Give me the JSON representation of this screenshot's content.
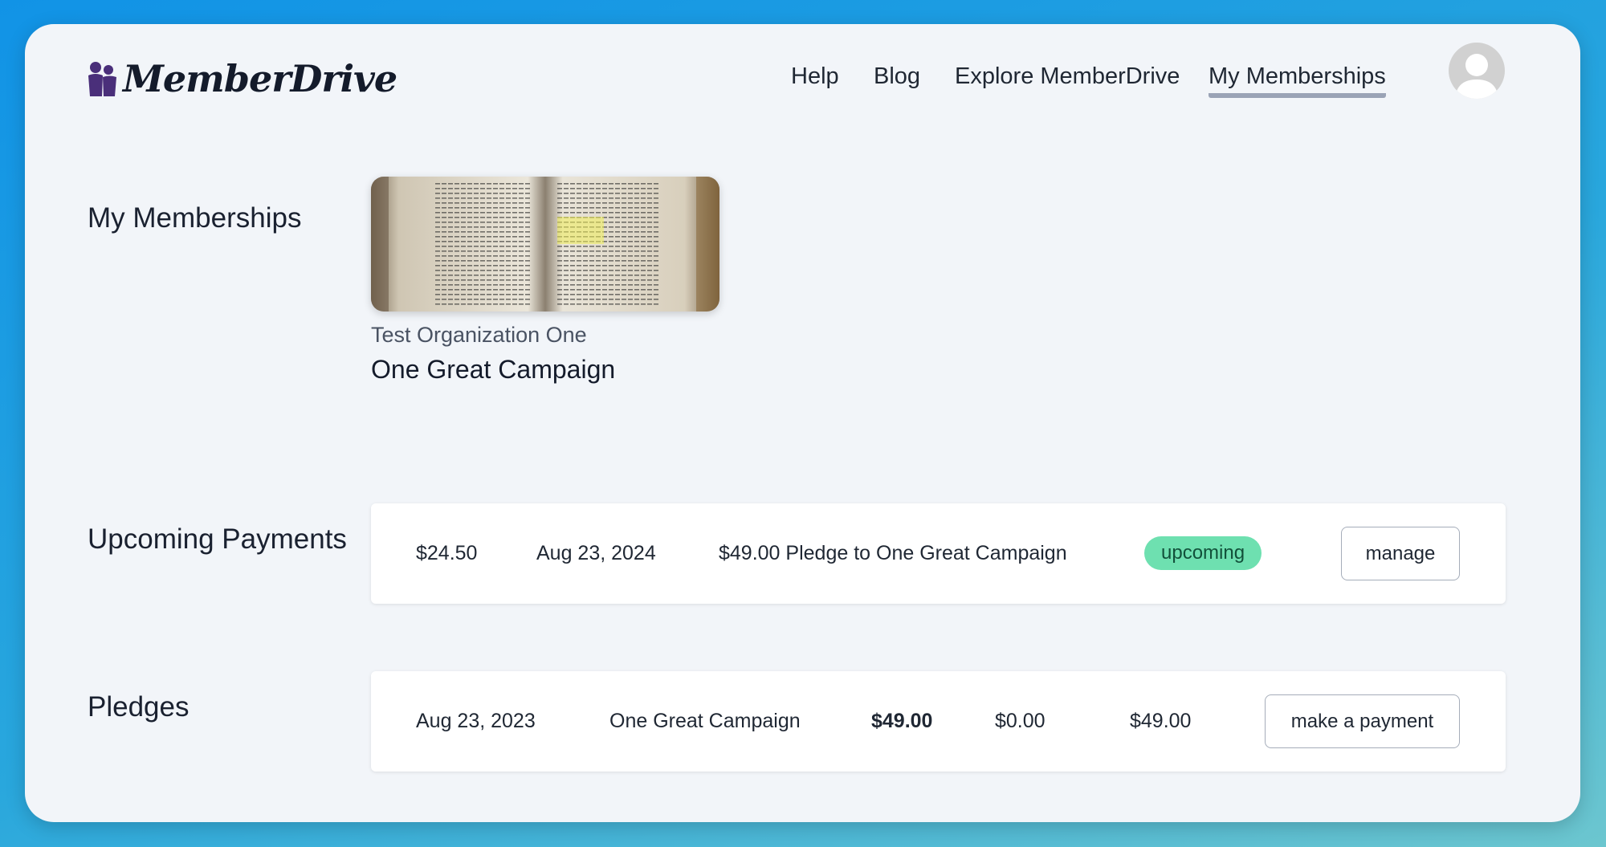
{
  "header": {
    "logo_text": "MemberDrive",
    "nav": [
      {
        "label": "Help"
      },
      {
        "label": "Blog"
      },
      {
        "label": "Explore MemberDrive"
      },
      {
        "label": "My Memberships"
      }
    ],
    "active_nav": "My Memberships"
  },
  "memberships": {
    "title": "My Memberships",
    "items": [
      {
        "org": "Test Organization One",
        "campaign": "One Great Campaign"
      }
    ]
  },
  "upcoming_payments": {
    "title": "Upcoming Payments",
    "rows": [
      {
        "amount": "$24.50",
        "date": "Aug 23, 2024",
        "description": "$49.00 Pledge to One Great Campaign",
        "status": "upcoming",
        "action_label": "manage"
      }
    ]
  },
  "pledges": {
    "title": "Pledges",
    "rows": [
      {
        "date": "Aug 23, 2023",
        "campaign": "One Great Campaign",
        "total": "$49.00",
        "paid": "$0.00",
        "remaining": "$49.00",
        "action_label": "make a payment"
      }
    ]
  },
  "colors": {
    "background_gradient_start": "#1193e6",
    "window": "#f2f5f9",
    "status_upcoming": "#6ee0b0",
    "nav_active_underline": "#9aa3b6"
  }
}
